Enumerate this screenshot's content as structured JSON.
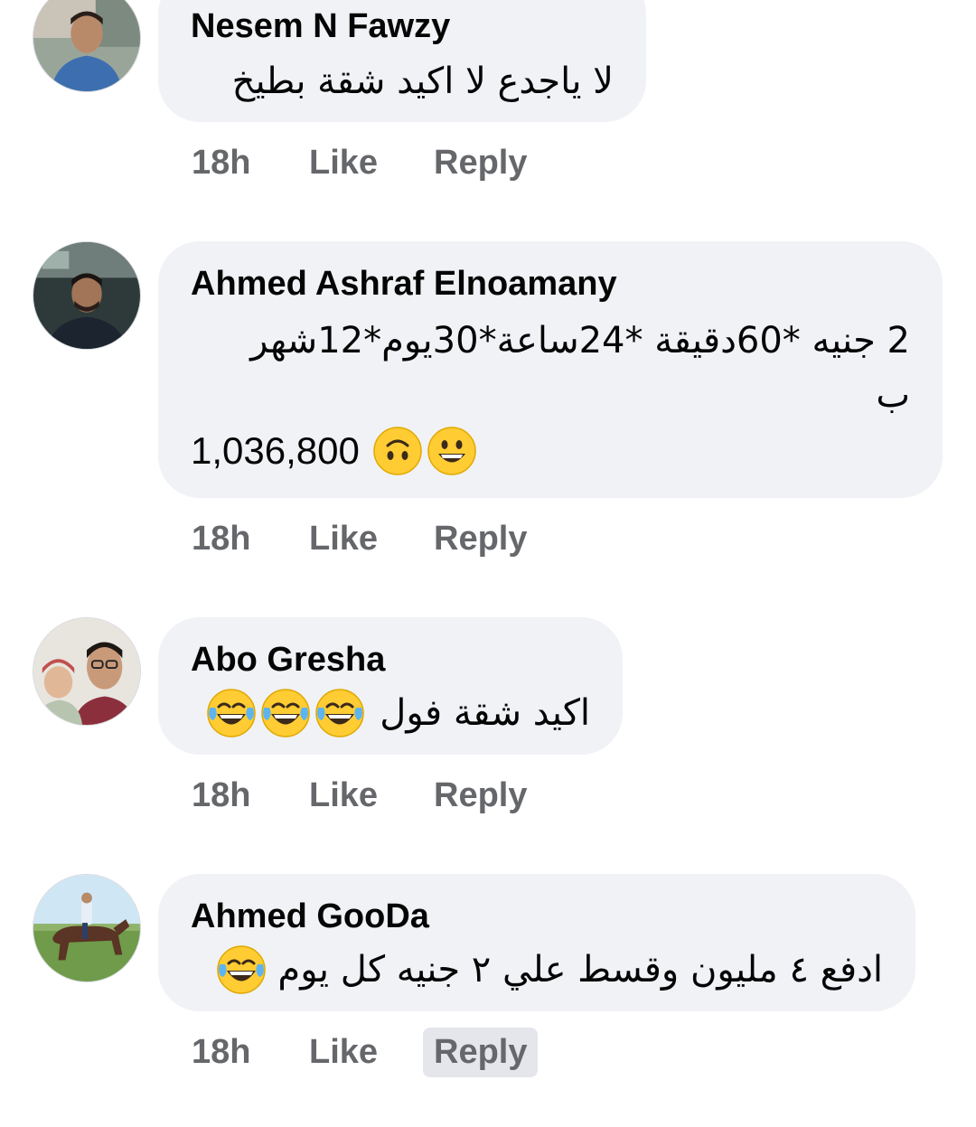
{
  "comments": [
    {
      "author": "Nesem N Fawzy",
      "text": "لا ياجدع لا اكيد شقة بطيخ",
      "time": "18h",
      "like_label": "Like",
      "reply_label": "Reply"
    },
    {
      "author": "Ahmed Ashraf Elnoamany",
      "text_line1": "2 جنيه  *60دقيقة *24ساعة*30يوم*12شهر",
      "text_line2": "ب",
      "result": "1,036,800",
      "time": "18h",
      "like_label": "Like",
      "reply_label": "Reply"
    },
    {
      "author": "Abo Gresha",
      "text": "اكيد شقة فول",
      "time": "18h",
      "like_label": "Like",
      "reply_label": "Reply"
    },
    {
      "author": "Ahmed GooDa",
      "text": "ادفع ٤ مليون وقسط علي ٢ جنيه كل يوم",
      "time": "18h",
      "like_label": "Like",
      "reply_label": "Reply"
    }
  ],
  "icons": {
    "laugh_emoji": "face-with-tears-of-joy-icon",
    "upside_down_emoji": "upside-down-face-icon",
    "smile_emoji": "grinning-face-icon"
  },
  "colors": {
    "bubble_bg": "#f0f2f5",
    "action_text": "#65676b",
    "active_reply_bg": "#e4e6eb",
    "emoji_yellow": "#ffcc33"
  }
}
